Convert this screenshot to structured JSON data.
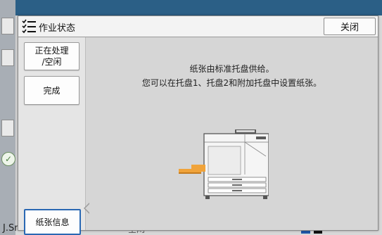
{
  "dialog": {
    "title": "作业状态",
    "close_label": "关闭"
  },
  "sidebar": {
    "items": [
      {
        "label": "正在处理\n/空闲"
      },
      {
        "label": "完成"
      },
      {
        "label": "纸张信息",
        "selected": true
      }
    ]
  },
  "main": {
    "message_line1": "纸张由标准托盘供给。",
    "message_line2": "您可以在托盘1、托盘2和附加托盘中设置纸张。"
  },
  "background": {
    "user_label": "J.Smith",
    "bottom_text": "空闲"
  },
  "colors": {
    "accent": "#2a68b3",
    "tray_orange": "#f0a33a"
  }
}
